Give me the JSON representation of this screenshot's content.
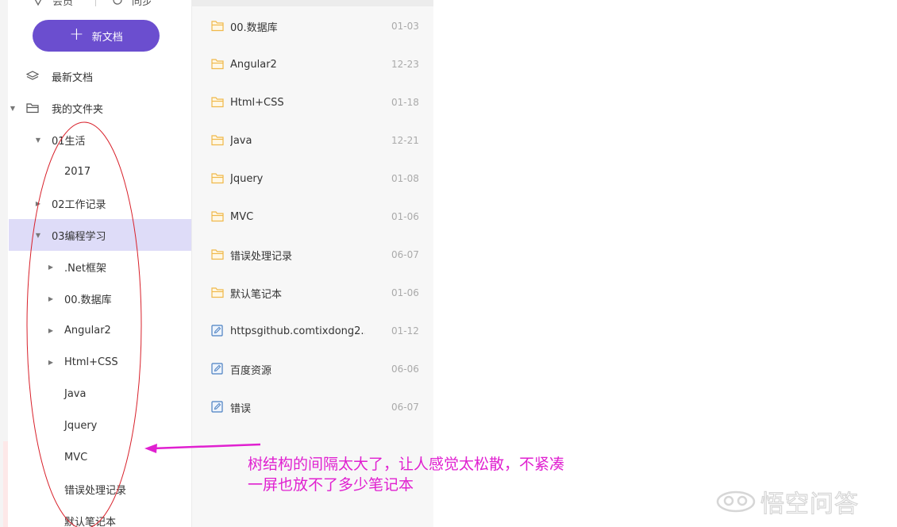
{
  "toolbar": {
    "share_label": "会员",
    "sync_label": "同步"
  },
  "sidebar": {
    "new_doc_label": "新文档",
    "latest_docs_label": "最新文档",
    "my_folder_label": "我的文件夹",
    "tree": [
      {
        "label": "01生活",
        "level": 1,
        "caret": "down"
      },
      {
        "label": "2017",
        "level": 2,
        "caret": "none"
      },
      {
        "label": "02工作记录",
        "level": 1,
        "caret": "right"
      },
      {
        "label": "03编程学习",
        "level": 1,
        "caret": "down",
        "selected": true
      },
      {
        "label": ".Net框架",
        "level": 2,
        "caret": "right"
      },
      {
        "label": "00.数据库",
        "level": 2,
        "caret": "right"
      },
      {
        "label": "Angular2",
        "level": 2,
        "caret": "right"
      },
      {
        "label": "Html+CSS",
        "level": 2,
        "caret": "right"
      },
      {
        "label": "Java",
        "level": 2,
        "caret": "none"
      },
      {
        "label": "Jquery",
        "level": 2,
        "caret": "none"
      },
      {
        "label": "MVC",
        "level": 2,
        "caret": "none"
      },
      {
        "label": "错误处理记录",
        "level": 2,
        "caret": "none"
      },
      {
        "label": "默认笔记本",
        "level": 2,
        "caret": "none"
      }
    ]
  },
  "doc_list": [
    {
      "title": "00.数据库",
      "date": "01-03",
      "icon": "folder-icon"
    },
    {
      "title": "Angular2",
      "date": "12-23",
      "icon": "folder-icon"
    },
    {
      "title": "Html+CSS",
      "date": "01-18",
      "icon": "folder-icon"
    },
    {
      "title": "Java",
      "date": "12-21",
      "icon": "folder-icon"
    },
    {
      "title": "Jquery",
      "date": "01-08",
      "icon": "folder-icon"
    },
    {
      "title": "MVC",
      "date": "01-06",
      "icon": "folder-icon"
    },
    {
      "title": "错误处理记录",
      "date": "06-07",
      "icon": "folder-icon"
    },
    {
      "title": "默认笔记本",
      "date": "01-06",
      "icon": "folder-icon"
    },
    {
      "title": "httpsgithub.comtixdong2...",
      "date": "01-12",
      "icon": "note-icon"
    },
    {
      "title": "百度资源",
      "date": "06-06",
      "icon": "note-icon"
    },
    {
      "title": "错误",
      "date": "06-07",
      "icon": "note-icon"
    }
  ],
  "annotation": {
    "line1": "树结构的间隔太大了，让人感觉太松散，不紧凑",
    "line2": "一屏也放不了多少笔记本",
    "color": "#e020d0"
  },
  "watermark": {
    "text": "悟空问答"
  },
  "colors": {
    "accent": "#6b4ecf",
    "selected_row": "#dedcf8",
    "folder": "#f0b84a",
    "note": "#4a7fc1"
  }
}
